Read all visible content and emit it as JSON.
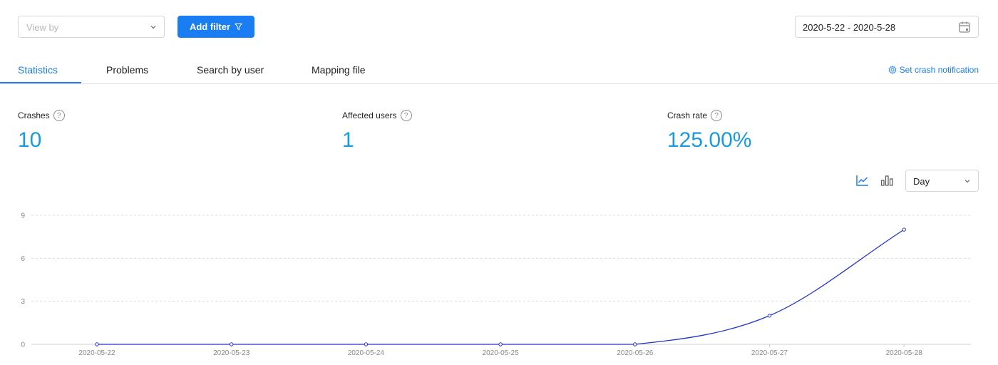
{
  "toolbar": {
    "view_by_placeholder": "View by",
    "add_filter_label": "Add filter",
    "date_range": "2020-5-22 - 2020-5-28"
  },
  "tabs": [
    {
      "label": "Statistics",
      "active": true
    },
    {
      "label": "Problems",
      "active": false
    },
    {
      "label": "Search by user",
      "active": false
    },
    {
      "label": "Mapping file",
      "active": false
    }
  ],
  "set_notification_label": "Set crash notification",
  "stats": {
    "crashes": {
      "label": "Crashes",
      "value": "10"
    },
    "affected_users": {
      "label": "Affected users",
      "value": "1"
    },
    "crash_rate": {
      "label": "Crash rate",
      "value": "125.00%"
    }
  },
  "chart_controls": {
    "active_view": "line",
    "period": "Day"
  },
  "colors": {
    "accent": "#1a7df2",
    "stat_value": "#1a9ae0",
    "series_line": "#2233cc"
  },
  "chart_data": {
    "type": "line",
    "categories": [
      "2020-05-22",
      "2020-05-23",
      "2020-05-24",
      "2020-05-25",
      "2020-05-26",
      "2020-05-27",
      "2020-05-28"
    ],
    "values": [
      0,
      0,
      0,
      0,
      0,
      2,
      8
    ],
    "yticks": [
      0,
      3,
      6,
      9
    ],
    "ylim": [
      0,
      9
    ],
    "grid": true,
    "legend": "none"
  }
}
